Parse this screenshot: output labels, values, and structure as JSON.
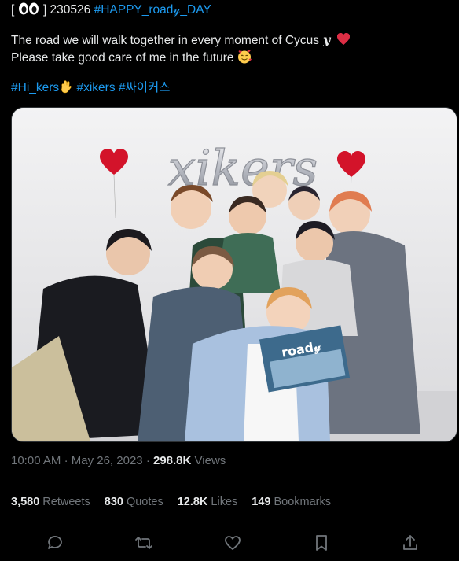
{
  "tweet": {
    "line1_prefix": "[",
    "line1_suffix": "] 230526",
    "hashtag_title": "#HAPPY_road𝓎_DAY",
    "body_line1": "The road we will walk together in every moment of Cycus",
    "body_line2": "Please take good care of me in the future",
    "tag1": "#Hi_kers",
    "tag2": "#xikers",
    "tag3": "#싸이커스",
    "icons": [
      "eyes-icon",
      "y-letter-icon",
      "red-heart-icon",
      "smiling-hearts-icon",
      "waving-hand-icon"
    ]
  },
  "media": {
    "balloon_text": "xikers",
    "card_text": "road𝓎"
  },
  "meta": {
    "time": "10:00 AM",
    "separator": "·",
    "date": "May 26, 2023",
    "views_count": "298.8K",
    "views_label": "Views"
  },
  "stats": [
    {
      "count": "3,580",
      "label": "Retweets"
    },
    {
      "count": "830",
      "label": "Quotes"
    },
    {
      "count": "12.8K",
      "label": "Likes"
    },
    {
      "count": "149",
      "label": "Bookmarks"
    }
  ],
  "colors": {
    "accent": "#1d9bf0",
    "background": "#000000",
    "text": "#e7e9ea",
    "muted": "#71767b",
    "divider": "#2f3336"
  }
}
